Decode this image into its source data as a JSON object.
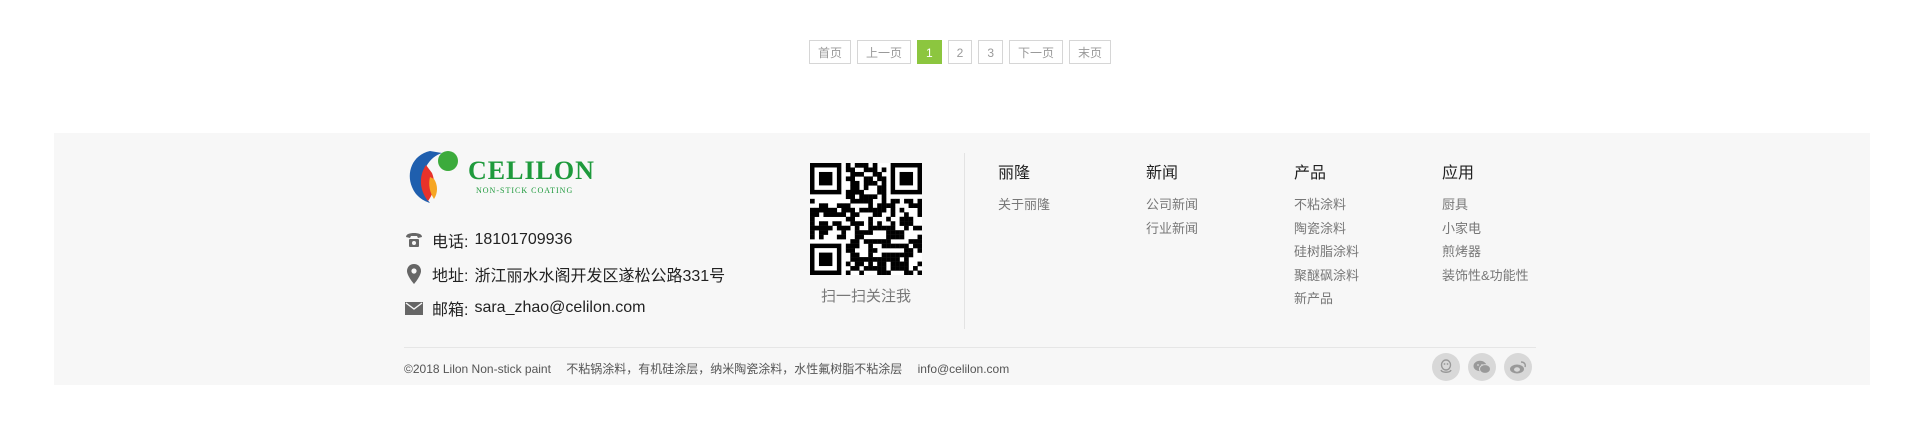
{
  "pagination": {
    "first": "首页",
    "prev": "上一页",
    "pages": [
      "1",
      "2",
      "3"
    ],
    "current": "1",
    "next": "下一页",
    "last": "末页",
    "active_color": "#8cc63f"
  },
  "footer": {
    "logo": {
      "name": "CELILON",
      "tagline": "NON-STICK COATING",
      "brand_color": "#1e9a3c"
    },
    "contact": {
      "phone_label": "电话:",
      "phone": "18101709936",
      "address_label": "地址:",
      "address": "浙江丽水水阁开发区遂松公路331号",
      "email_label": "邮箱:",
      "email": "sara_zhao@celilon.com"
    },
    "qr_caption": "扫一扫关注我",
    "columns": [
      {
        "title": "丽隆",
        "links": [
          "关于丽隆"
        ]
      },
      {
        "title": "新闻",
        "links": [
          "公司新闻",
          "行业新闻"
        ]
      },
      {
        "title": "产品",
        "links": [
          "不粘涂料",
          "陶瓷涂料",
          "硅树脂涂料",
          "聚醚砜涂料",
          "新产品"
        ]
      },
      {
        "title": "应用",
        "links": [
          "厨具",
          "小家电",
          "煎烤器",
          "装饰性&功能性"
        ]
      }
    ],
    "copyright": "©2018 Lilon Non-stick paint",
    "keywords": "不粘锅涂料，有机硅涂层，纳米陶瓷涂料，水性氟树脂不粘涂层",
    "copyright_email": "info@celilon.com",
    "social_icons": [
      "qq-icon",
      "wechat-icon",
      "weibo-icon"
    ]
  }
}
